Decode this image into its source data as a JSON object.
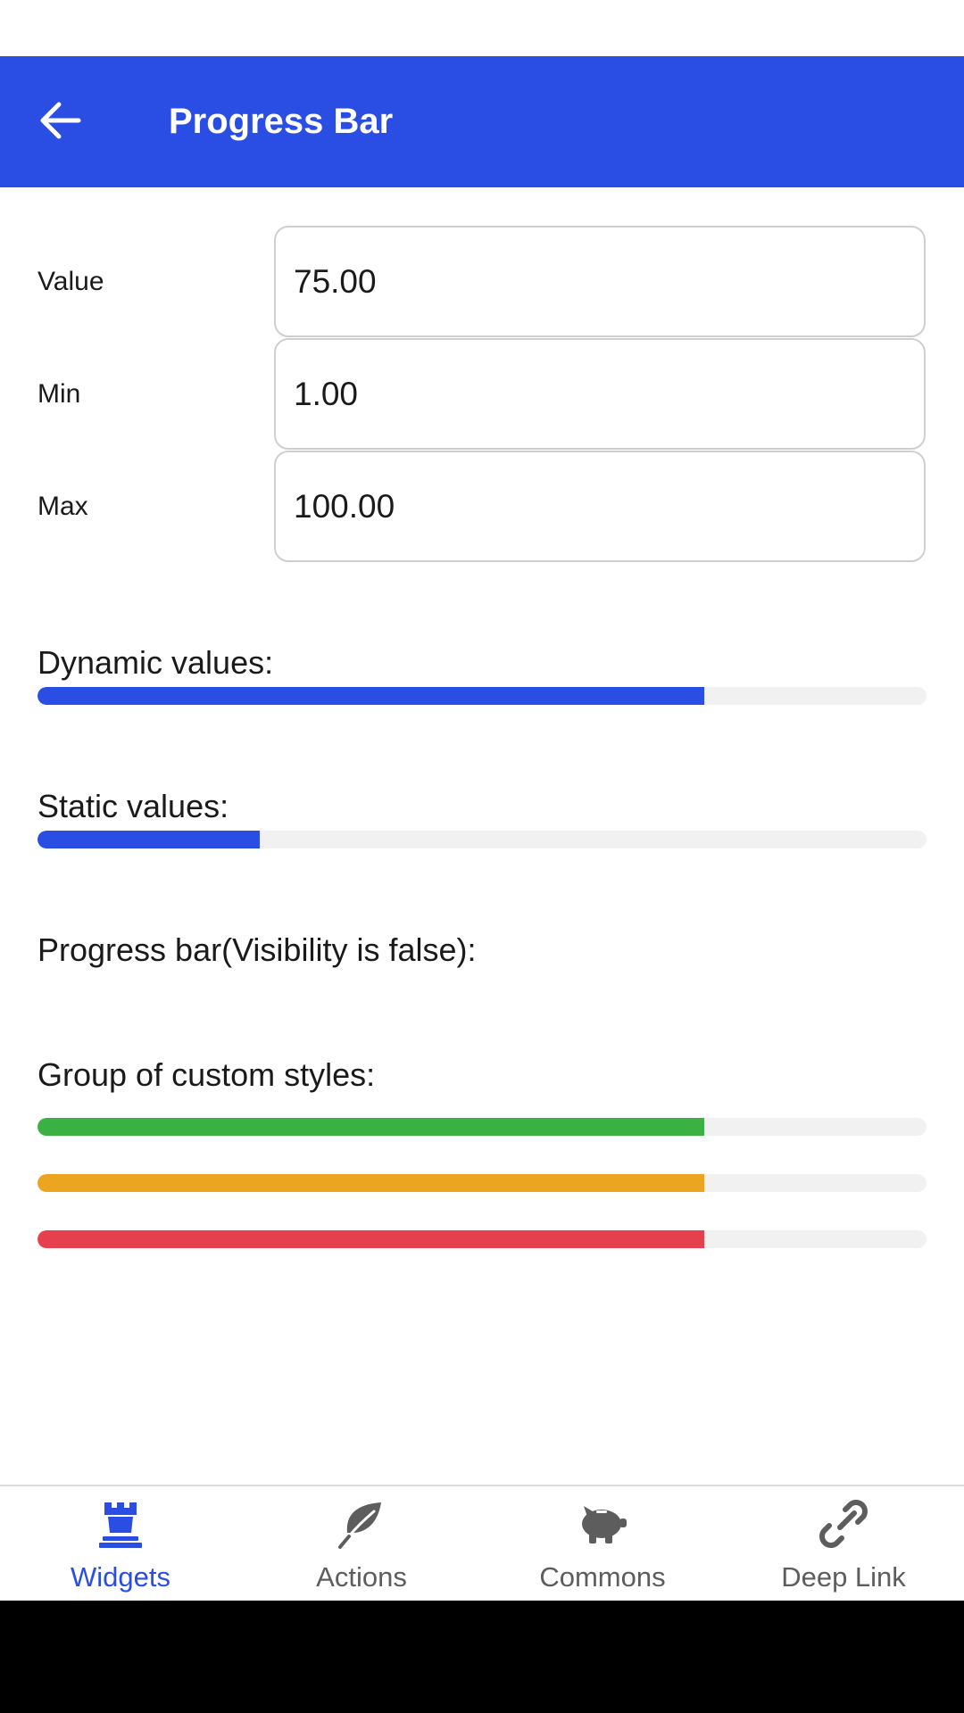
{
  "app_bar": {
    "title": "Progress Bar",
    "back_icon": "arrow-left-icon",
    "color": "#2a4ee3"
  },
  "form": {
    "fields": [
      {
        "label": "Value",
        "value": "75.00"
      },
      {
        "label": "Min",
        "value": "1.00"
      },
      {
        "label": "Max",
        "value": "100.00"
      }
    ]
  },
  "sections": {
    "dynamic": {
      "label": "Dynamic values:",
      "progress": 0.75,
      "color": "#2a4ee3"
    },
    "static": {
      "label": "Static values:",
      "progress": 0.25,
      "color": "#2a4ee3"
    },
    "hidden": {
      "label": "Progress bar(Visibility is false):"
    },
    "custom": {
      "label": "Group of custom styles:",
      "bars": [
        {
          "progress": 0.75,
          "color": "#3bb143"
        },
        {
          "progress": 0.75,
          "color": "#eba520"
        },
        {
          "progress": 0.75,
          "color": "#e6404f"
        }
      ]
    }
  },
  "track_color": "#f1f1f1",
  "bottom_nav": {
    "items": [
      {
        "label": "Widgets",
        "icon": "chess-rook-icon",
        "active": true
      },
      {
        "label": "Actions",
        "icon": "leaf-icon",
        "active": false
      },
      {
        "label": "Commons",
        "icon": "piggy-bank-icon",
        "active": false
      },
      {
        "label": "Deep Link",
        "icon": "link-icon",
        "active": false
      }
    ],
    "active_color": "#2a4ee3",
    "inactive_color": "#5d5d5d"
  }
}
